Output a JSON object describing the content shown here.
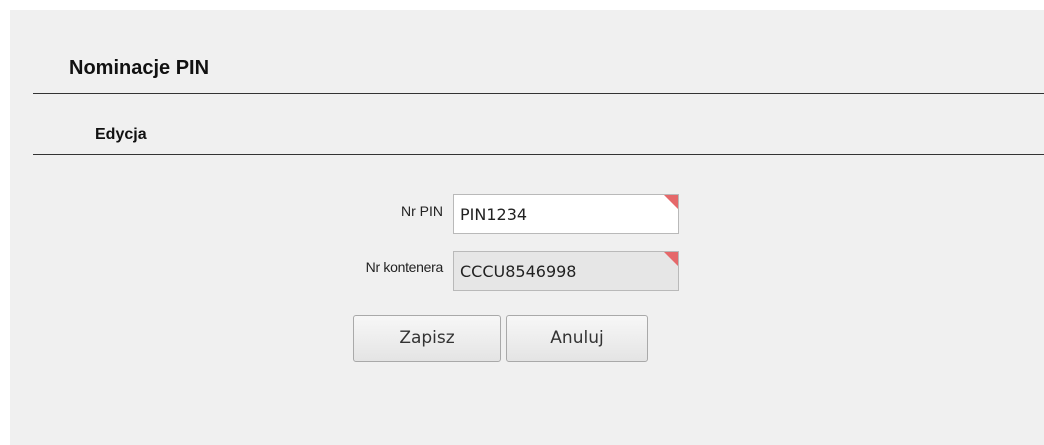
{
  "header": {
    "title": "Nominacje PIN"
  },
  "section": {
    "title": "Edycja"
  },
  "form": {
    "pin": {
      "label": "Nr PIN",
      "value": "PIN1234"
    },
    "container": {
      "label": "Nr kontenera",
      "value": "CCCU8546998"
    }
  },
  "actions": {
    "save_label": "Zapisz",
    "cancel_label": "Anuluj"
  },
  "colors": {
    "background": "#f0f0f0",
    "required_marker": "#e5686a",
    "readonly_field": "#e6e6e6"
  }
}
